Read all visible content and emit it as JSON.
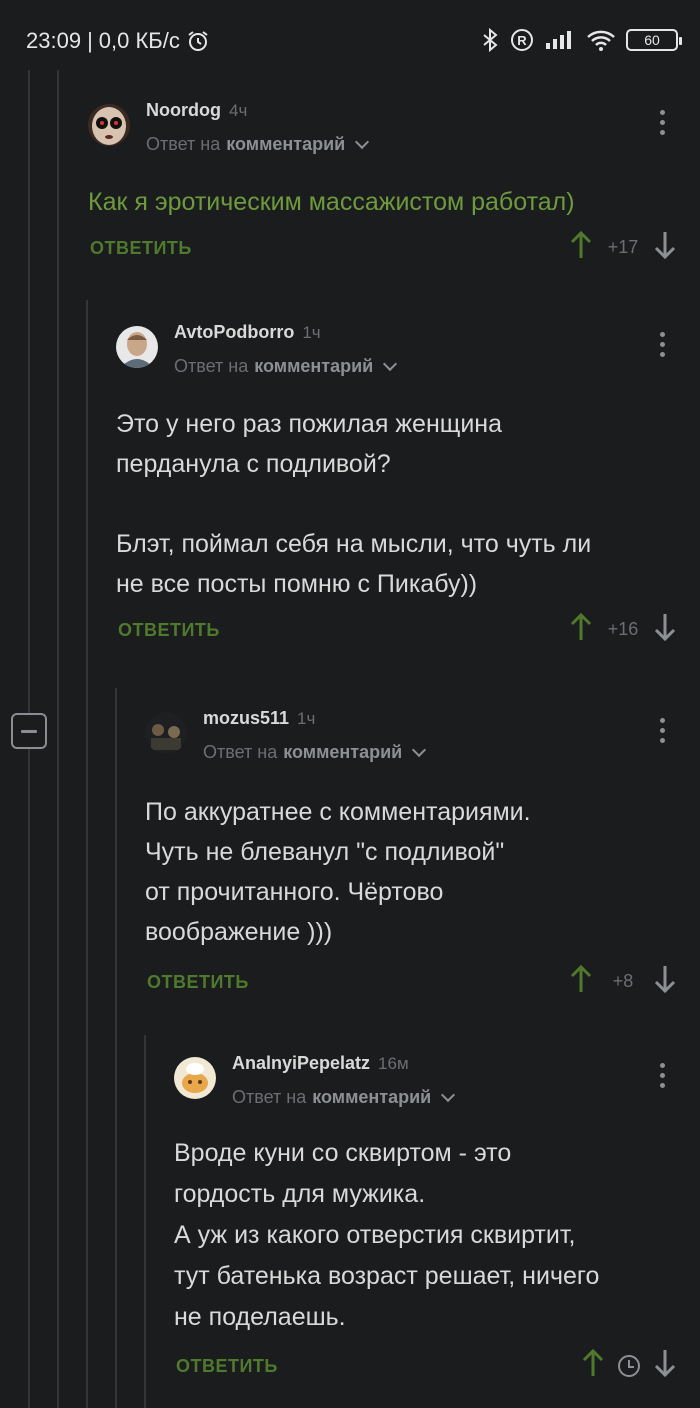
{
  "status_bar": {
    "time": "23:09",
    "network_speed": "0,0 КБ/с",
    "battery": "60",
    "icons": [
      "alarm-icon",
      "bluetooth-icon",
      "registered-icon",
      "signal-icon",
      "wifi-icon",
      "battery-icon"
    ]
  },
  "colors": {
    "background": "#1b1c1e",
    "accent_green": "#6e9a3e",
    "reply_green": "#4f7a2e",
    "muted_text": "#6b6e72"
  },
  "comments": [
    {
      "author": "Noordog",
      "time": "4ч",
      "reply_prefix": "Ответ на",
      "reply_target": "комментарий",
      "text": "Как я эротическим массажистом работал)",
      "reply_label": "ОТВЕТИТЬ",
      "rating": "+17",
      "avatar": "creepy-face-avatar"
    },
    {
      "author": "AvtoPodborro",
      "time": "1ч",
      "reply_prefix": "Ответ на",
      "reply_target": "комментарий",
      "text": "Это  у него раз пожилая женщина\nперданула с подливой?\n\nБлэт, поймал себя на мысли, что  чуть ли\nне все посты помню с Пикабу))",
      "reply_label": "ОТВЕТИТЬ",
      "rating": "+16",
      "avatar": "man-photo-avatar"
    },
    {
      "author": "mozus511",
      "time": "1ч",
      "reply_prefix": "Ответ на",
      "reply_target": "комментарий",
      "text": "По аккуратнее с комментариями.\nЧуть не блеванул \"с подливой\"\nот прочитанного. Чёртово\nвоображение )))",
      "reply_label": "ОТВЕТИТЬ",
      "rating": "+8",
      "avatar": "dark-photo-avatar"
    },
    {
      "author": "AnalnyiPepelatz",
      "time": "16м",
      "reply_prefix": "Ответ на",
      "reply_target": "комментарий",
      "text": "Вроде куни со сквиртом - это\nгордость для мужика.\nА уж из какого отверстия сквиртит,\nтут батенька возраст решает, ничего\nне поделаешь.",
      "reply_label": "ОТВЕТИТЬ",
      "rating": "",
      "rating_icon": "clock-icon",
      "avatar": "cartoon-avatar"
    }
  ]
}
